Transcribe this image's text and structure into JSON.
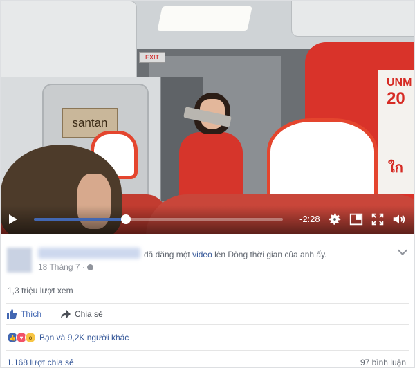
{
  "video": {
    "scene": {
      "exit_sign": "EXIT",
      "santan_sign": "santan",
      "poster_lines": [
        "UNM",
        "20",
        "ใก"
      ]
    },
    "controls": {
      "time_remaining": "-2:28",
      "progress_fraction": 0.37,
      "icons": [
        "play-icon",
        "settings-gear-icon",
        "picture-in-picture-icon",
        "fullscreen-icon",
        "volume-icon"
      ]
    }
  },
  "post": {
    "headline_pre": "đã đăng một ",
    "headline_link": "video",
    "headline_post": " lên Dòng thời gian của anh ấy.",
    "date": "18 Tháng 7 · ",
    "views": "1,3 triệu lượt xem"
  },
  "actions": {
    "like_label": "Thích",
    "share_label": "Chia sẻ"
  },
  "reactions": {
    "icons": [
      "like-reaction-icon",
      "love-reaction-icon",
      "wow-reaction-icon"
    ],
    "text": "Bạn và 9,2K người khác"
  },
  "footer": {
    "shares": "1.168 lượt chia sẻ",
    "comments": "97 bình luận"
  },
  "colors": {
    "fb_blue": "#4267b2",
    "link_blue": "#365899",
    "muted_text": "#90949c"
  }
}
